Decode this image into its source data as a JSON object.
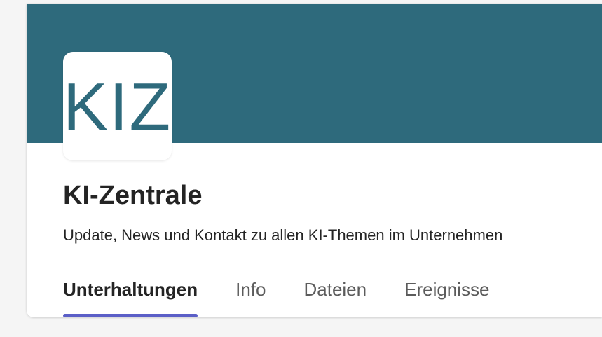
{
  "team": {
    "logo_text": "KIZ",
    "name": "KI-Zentrale",
    "description": "Update, News und Kontakt zu allen KI-Themen im Unternehmen"
  },
  "tabs": [
    {
      "label": "Unterhaltungen",
      "active": true
    },
    {
      "label": "Info",
      "active": false
    },
    {
      "label": "Dateien",
      "active": false
    },
    {
      "label": "Ereignisse",
      "active": false
    }
  ],
  "colors": {
    "banner": "#2e6a7c",
    "logo_text": "#2e6a7c",
    "tab_indicator": "#5b5fc7"
  }
}
